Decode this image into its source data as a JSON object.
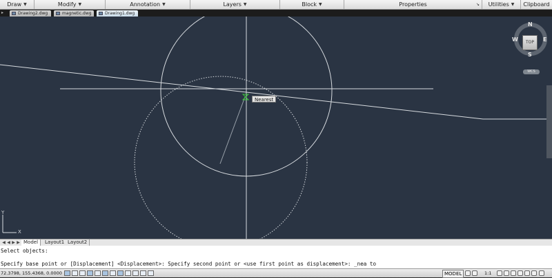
{
  "ribbon": {
    "panels": [
      {
        "label": "Draw",
        "has_menu": true
      },
      {
        "label": "Modify",
        "has_menu": true
      },
      {
        "label": "Annotation",
        "has_menu": true
      },
      {
        "label": "Layers",
        "has_menu": true
      },
      {
        "label": "Block",
        "has_menu": true
      },
      {
        "label": "Properties",
        "has_menu": false
      },
      {
        "label": "Utilities",
        "has_menu": true
      },
      {
        "label": "Clipboard",
        "has_menu": false
      }
    ],
    "caret": "▼"
  },
  "file_tabs": [
    {
      "label": "Drawing2.dwg",
      "active": false
    },
    {
      "label": "magnetic.dwg",
      "active": false
    },
    {
      "label": "Drawing1.dwg",
      "active": true
    }
  ],
  "canvas": {
    "background": "#2a3443",
    "line_color": "#d8dce0",
    "osnap_marker_color": "#3cc43c",
    "osnap_tooltip": "Nearest"
  },
  "viewcube": {
    "top_face": "TOP",
    "north": "N",
    "south": "S",
    "east": "E",
    "west": "W",
    "wcs_label": "WCS"
  },
  "ucs_icon": {
    "x_label": "X",
    "y_label": "Y"
  },
  "layout_tabs": [
    {
      "label": "Model",
      "active": true
    },
    {
      "label": "Layout1",
      "active": false
    },
    {
      "label": "Layout2",
      "active": false
    }
  ],
  "command_line": {
    "history": "Select objects:",
    "current": "Specify base point or [Displacement] <Displacement>: Specify second point or <use first point as displacement>: _nea to"
  },
  "status_bar": {
    "coordinates": "72.3798, 155.4368, 0.0000",
    "model_label": "MODEL",
    "annotation_scale": "1:1"
  }
}
